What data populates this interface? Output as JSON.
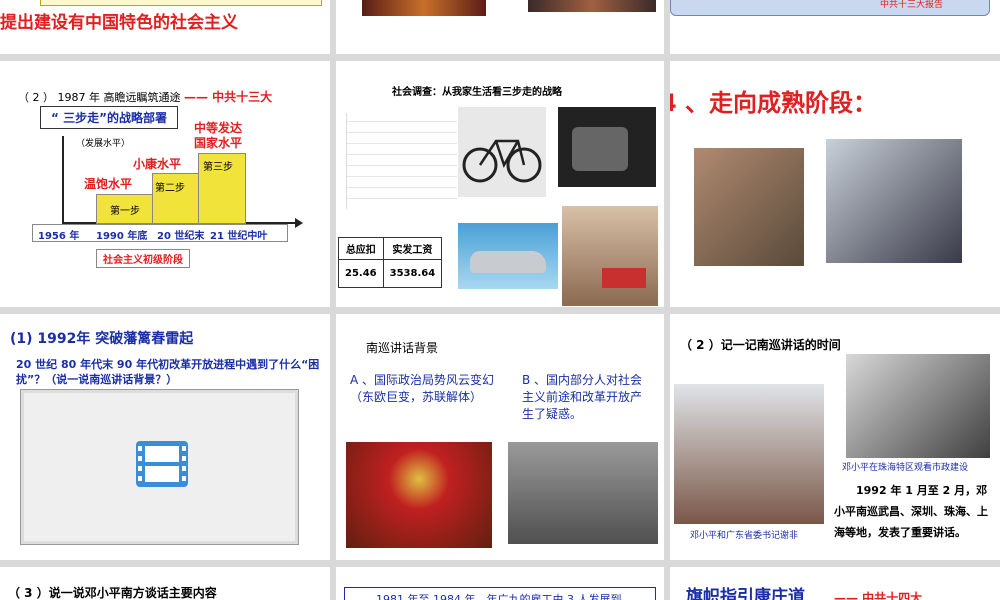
{
  "r1": {
    "s1_text": "提出建设有中国特色的社会主义",
    "s3_caption": "中共十三大报告"
  },
  "r2": {
    "s1": {
      "heading_prefix": "（ 2 ） 1987 年 高瞻远瞩筑通途",
      "heading_suffix": "—— 中共十三大",
      "box_title": "“ 三步走”的战略部署",
      "ylabel": "（发展水平）",
      "labels": {
        "wb": "温饱水平",
        "xk": "小康水平",
        "zd": "中等发达国家水平"
      },
      "steps": [
        "第一步",
        "第二步",
        "第三步"
      ],
      "years": [
        "1956 年",
        "1990 年底",
        "20 世纪末",
        "21 世纪中叶"
      ],
      "stage": "社会主义初级阶段"
    },
    "s2": {
      "title": "社会调查：从我家生活看三步走的战略",
      "tbl_h": [
        "总应扣",
        "实发工资"
      ],
      "tbl_v": [
        "25.46",
        "3538.64"
      ]
    },
    "s3": {
      "title": "4 、走向成熟阶段："
    }
  },
  "r3": {
    "s1": {
      "title": "(1) 1992年 突破藩篱春雷起",
      "question": "20 世纪 80 年代末 90 年代初改革开放进程中遇到了什么“困扰”？（说一说南巡讲话背景？）"
    },
    "s2": {
      "title": "南巡讲话背景",
      "a": "A 、国际政治局势风云变幻（东欧巨变，苏联解体）",
      "b": "B 、国内部分人对社会主义前途和改革开放产生了疑惑。"
    },
    "s3": {
      "title": "（ 2 ）记一记南巡讲话的时间",
      "cap1": "邓小平在珠海特区观看市政建设",
      "cap2": "邓小平和广东省委书记谢非",
      "body": "1992 年 1 月至 2 月，邓小平南巡武昌、深圳、珠海、上海等地，发表了重要讲话。"
    }
  },
  "r4": {
    "s1": "（ 3 ）说一说邓小平南方谈话主要内容",
    "s2": "1981 年至 1984 年，年广九的雇工由 3 人发展到",
    "s3_a": "旗帜指引康庄道",
    "s3_b": "—— 中共十四大"
  },
  "colors": {
    "red": "#e02020",
    "blue": "#1a2ea8",
    "yellow": "#f2e33a"
  }
}
